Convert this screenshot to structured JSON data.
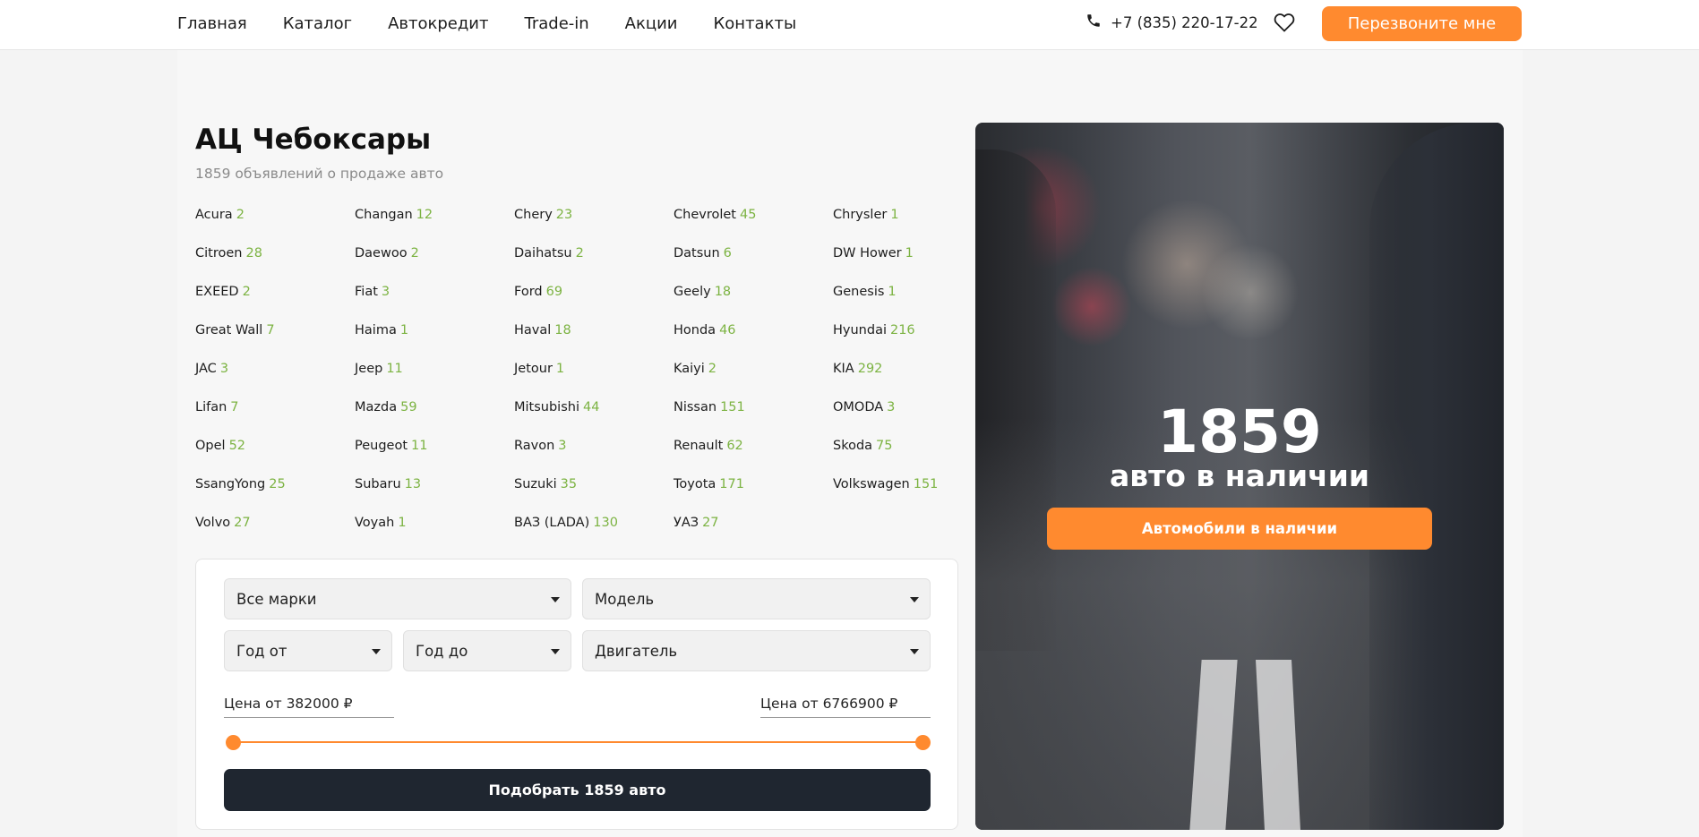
{
  "nav": {
    "items": [
      "Главная",
      "Каталог",
      "Автокредит",
      "Trade-in",
      "Акции",
      "Контакты"
    ],
    "phone": "+7 (835) 220-17-22",
    "callback_label": "Перезвоните мне"
  },
  "main": {
    "title": "АЦ Чебоксары",
    "subtitle": "1859 объявлений о продаже авто"
  },
  "brands": [
    {
      "name": "Acura",
      "count": "2"
    },
    {
      "name": "Changan",
      "count": "12"
    },
    {
      "name": "Chery",
      "count": "23"
    },
    {
      "name": "Chevrolet",
      "count": "45"
    },
    {
      "name": "Chrysler",
      "count": "1"
    },
    {
      "name": "Citroen",
      "count": "28"
    },
    {
      "name": "Daewoo",
      "count": "2"
    },
    {
      "name": "Daihatsu",
      "count": "2"
    },
    {
      "name": "Datsun",
      "count": "6"
    },
    {
      "name": "DW Hower",
      "count": "1"
    },
    {
      "name": "EXEED",
      "count": "2"
    },
    {
      "name": "Fiat",
      "count": "3"
    },
    {
      "name": "Ford",
      "count": "69"
    },
    {
      "name": "Geely",
      "count": "18"
    },
    {
      "name": "Genesis",
      "count": "1"
    },
    {
      "name": "Great Wall",
      "count": "7"
    },
    {
      "name": "Haima",
      "count": "1"
    },
    {
      "name": "Haval",
      "count": "18"
    },
    {
      "name": "Honda",
      "count": "46"
    },
    {
      "name": "Hyundai",
      "count": "216"
    },
    {
      "name": "JAC",
      "count": "3"
    },
    {
      "name": "Jeep",
      "count": "11"
    },
    {
      "name": "Jetour",
      "count": "1"
    },
    {
      "name": "Kaiyi",
      "count": "2"
    },
    {
      "name": "KIA",
      "count": "292"
    },
    {
      "name": "Lifan",
      "count": "7"
    },
    {
      "name": "Mazda",
      "count": "59"
    },
    {
      "name": "Mitsubishi",
      "count": "44"
    },
    {
      "name": "Nissan",
      "count": "151"
    },
    {
      "name": "OMODA",
      "count": "3"
    },
    {
      "name": "Opel",
      "count": "52"
    },
    {
      "name": "Peugeot",
      "count": "11"
    },
    {
      "name": "Ravon",
      "count": "3"
    },
    {
      "name": "Renault",
      "count": "62"
    },
    {
      "name": "Skoda",
      "count": "75"
    },
    {
      "name": "SsangYong",
      "count": "25"
    },
    {
      "name": "Subaru",
      "count": "13"
    },
    {
      "name": "Suzuki",
      "count": "35"
    },
    {
      "name": "Toyota",
      "count": "171"
    },
    {
      "name": "Volkswagen",
      "count": "151"
    },
    {
      "name": "Volvo",
      "count": "27"
    },
    {
      "name": "Voyah",
      "count": "1"
    },
    {
      "name": "ВАЗ (LADA)",
      "count": "130"
    },
    {
      "name": "УАЗ",
      "count": "27"
    }
  ],
  "filter": {
    "make": "Все марки",
    "model": "Модель",
    "year_from": "Год от",
    "year_to": "Год до",
    "engine": "Двигатель",
    "price_from": "Цена от 382000 ₽",
    "price_to": "Цена от 6766900 ₽",
    "range_min_fraction": 0,
    "range_max_fraction": 1,
    "submit_label": "Подобрать 1859 авто"
  },
  "promo": {
    "number": "1859",
    "text": "авто в наличии",
    "button_label": "Автомобили в наличии"
  },
  "colors": {
    "accent": "#ff8a2f",
    "count_green": "#7cb342",
    "dark_button": "#1f2630"
  }
}
